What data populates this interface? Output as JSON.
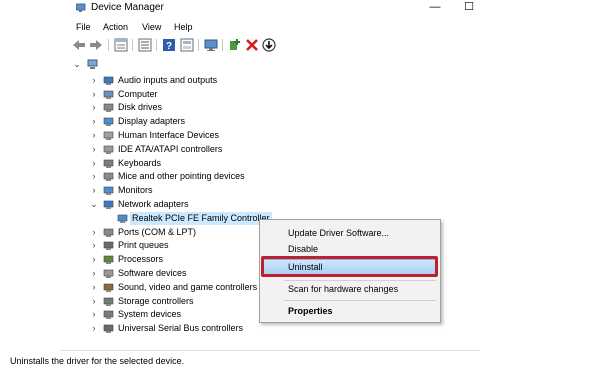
{
  "window": {
    "title": "Device Manager",
    "minimize": "—",
    "maximize": "☐"
  },
  "menu": [
    "File",
    "Action",
    "View",
    "Help"
  ],
  "toolbar": [
    "back-icon",
    "forward-icon",
    "properties-panel-icon",
    "list-icon",
    "help-icon",
    "view-icon",
    "monitor-icon",
    "add-driver-icon",
    "remove-icon",
    "download-icon"
  ],
  "tree": {
    "root": "",
    "nodes": [
      "Audio inputs and outputs",
      "Computer",
      "Disk drives",
      "Display adapters",
      "Human Interface Devices",
      "IDE ATA/ATAPI controllers",
      "Keyboards",
      "Mice and other pointing devices",
      "Monitors",
      "Network adapters",
      "Realtek PCIe FE Family Controller",
      "Ports (COM & LPT)",
      "Print queues",
      "Processors",
      "Software devices",
      "Sound, video and game controllers",
      "Storage controllers",
      "System devices",
      "Universal Serial Bus controllers"
    ]
  },
  "context_menu": {
    "items": [
      "Update Driver Software...",
      "Disable",
      "Uninstall",
      "Scan for hardware changes",
      "Properties"
    ],
    "highlighted": "Uninstall"
  },
  "status": "Uninstalls the driver for the selected device.",
  "colors": {
    "selection": "#cce8ff",
    "highlight_border": "#c0202b",
    "menu_bg": "#f2f2f2"
  }
}
